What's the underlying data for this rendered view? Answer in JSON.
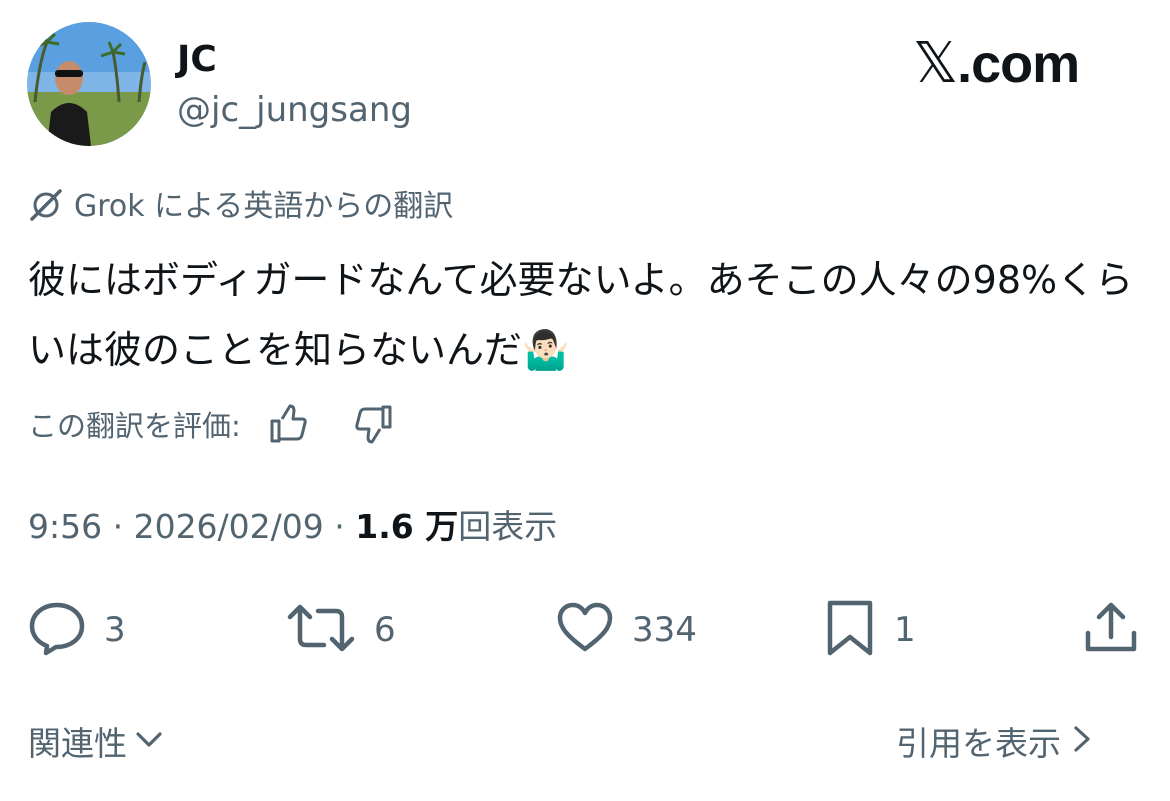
{
  "brand": {
    "x_symbol": "𝕏",
    "domain": ".com"
  },
  "author": {
    "name": "JC",
    "handle": "@jc_jungsang"
  },
  "translation": {
    "label": "Grok による英語からの翻訳",
    "icon": "grok-icon"
  },
  "tweet": {
    "text": "彼にはボディガードなんて必要ないよ。あそこの人々の98%くらいは彼のことを知らないんだ🤷🏻‍♂️"
  },
  "rating": {
    "label": "この翻訳を評価:"
  },
  "meta": {
    "time_date": "9:56 · 2026/02/09 · ",
    "views_count": "1.6 万",
    "views_label": "回表示"
  },
  "actions": {
    "replies": "3",
    "reposts": "6",
    "likes": "334",
    "bookmarks": "1"
  },
  "footer": {
    "related": "関連性",
    "quotes": "引用を表示"
  },
  "colors": {
    "text": "#0f1419",
    "secondary": "#536471"
  }
}
